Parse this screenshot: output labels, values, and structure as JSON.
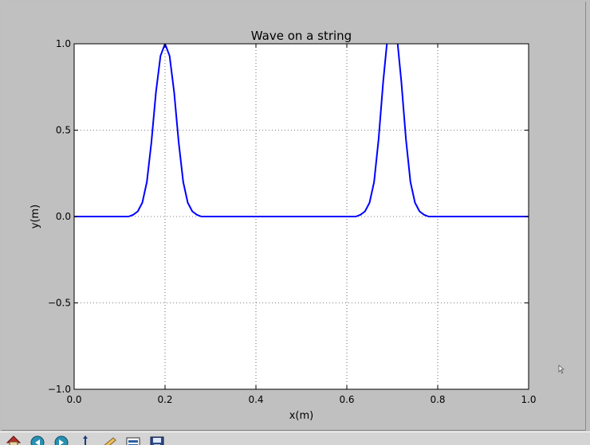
{
  "chart_data": {
    "type": "line",
    "title": "Wave on a string",
    "xlabel": "x(m)",
    "ylabel": "y(m)",
    "xlim": [
      0.0,
      1.0
    ],
    "ylim": [
      -1.0,
      1.0
    ],
    "xticks": [
      "0.0",
      "0.2",
      "0.4",
      "0.6",
      "0.8",
      "1.0"
    ],
    "yticks": [
      "−1.0",
      "−0.5",
      "0.0",
      "0.5",
      "1.0"
    ],
    "xtick_values": [
      0.0,
      0.2,
      0.4,
      0.6,
      0.8,
      1.0
    ],
    "ytick_values": [
      -1.0,
      -0.5,
      0.0,
      0.5,
      1.0
    ],
    "grid": true,
    "line_color": "#0000ff",
    "series": [
      {
        "x": [
          0.0,
          0.1,
          0.12,
          0.13,
          0.14,
          0.15,
          0.16,
          0.17,
          0.18,
          0.19,
          0.2,
          0.21,
          0.22,
          0.23,
          0.24,
          0.25,
          0.26,
          0.27,
          0.28,
          0.3,
          0.6,
          0.62,
          0.63,
          0.64,
          0.65,
          0.66,
          0.67,
          0.68,
          0.69,
          0.7,
          0.71,
          0.72,
          0.73,
          0.74,
          0.75,
          0.76,
          0.77,
          0.78,
          0.8,
          1.0
        ],
        "y": [
          0.0,
          0.0,
          0.0,
          0.01,
          0.03,
          0.08,
          0.2,
          0.43,
          0.72,
          0.93,
          1.0,
          0.93,
          0.72,
          0.43,
          0.2,
          0.08,
          0.03,
          0.01,
          0.0,
          0.0,
          0.0,
          0.0,
          0.01,
          0.03,
          0.08,
          0.2,
          0.45,
          0.78,
          1.05,
          1.15,
          1.05,
          0.78,
          0.45,
          0.2,
          0.08,
          0.03,
          0.01,
          0.0,
          0.0,
          0.0
        ]
      }
    ]
  },
  "toolbar": {
    "icons": [
      "home-icon",
      "back-icon",
      "forward-icon",
      "pan-icon",
      "zoom-icon",
      "subplots-icon",
      "save-icon"
    ]
  }
}
